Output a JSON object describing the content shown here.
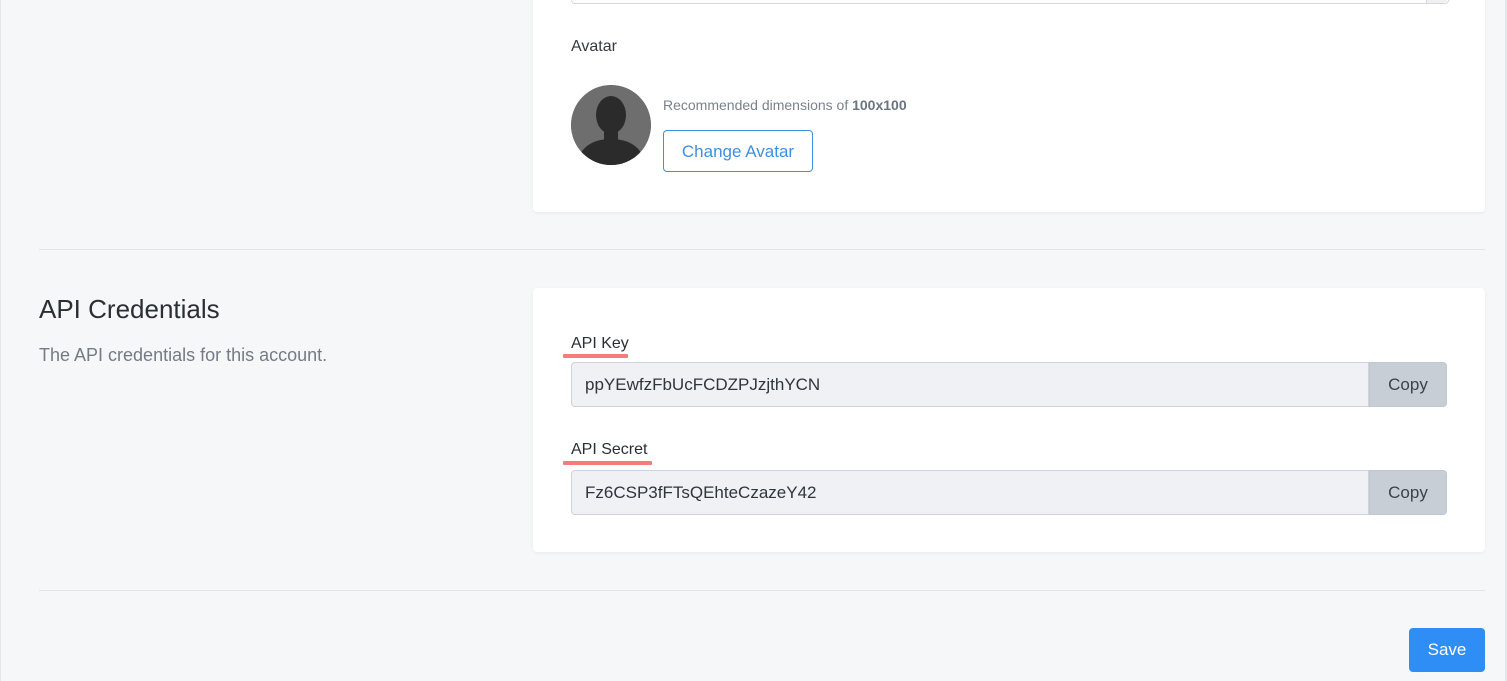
{
  "profile": {
    "avatar_label": "Avatar",
    "recommended_prefix": "Recommended dimensions of ",
    "recommended_value": "100x100",
    "change_avatar_label": "Change Avatar"
  },
  "api_credentials": {
    "title": "API Credentials",
    "description": "The API credentials for this account.",
    "key_label": "API Key",
    "key_value": "ppYEwfzFbUcFCDZPJzjthYCN",
    "secret_label": "API Secret",
    "secret_value": "Fz6CSP3fFTsQEhteCzazeY42",
    "copy_label": "Copy",
    "annotation_color": "#f47c7c"
  },
  "actions": {
    "save_label": "Save"
  },
  "colors": {
    "primary": "#2f8ef5",
    "outline_button": "#3f8fe0",
    "page_background": "#f6f7f9"
  },
  "icons": {
    "avatar": "user-silhouette-icon"
  }
}
